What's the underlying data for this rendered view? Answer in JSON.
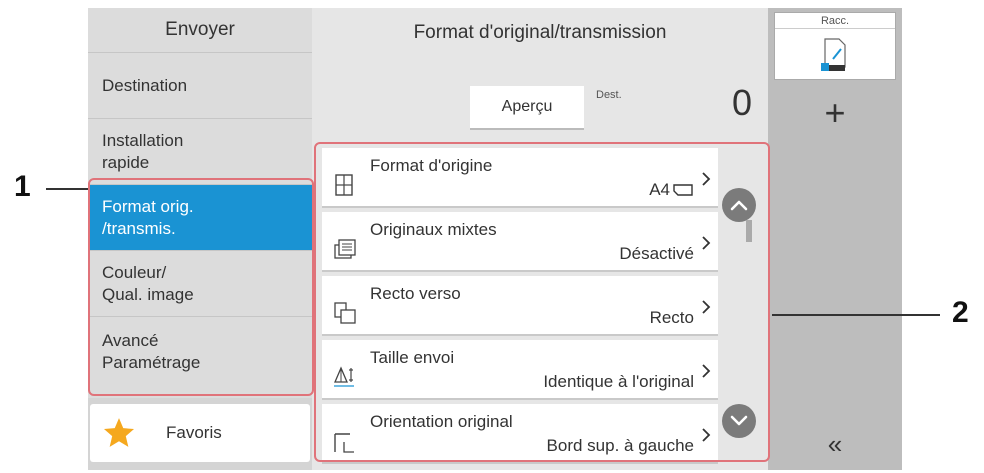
{
  "left_nav": {
    "header": "Envoyer",
    "items": [
      {
        "line1": "Destination",
        "line2": ""
      },
      {
        "line1": "Installation",
        "line2": "rapide"
      },
      {
        "line1": "Format orig.",
        "line2": "/transmis."
      },
      {
        "line1": "Couleur/",
        "line2": "Qual. image"
      },
      {
        "line1": "Avancé",
        "line2": "Paramétrage"
      }
    ],
    "active_index": 2,
    "favorites_label": "Favoris"
  },
  "center": {
    "title": "Format d'original/transmission",
    "tab_label": "Aperçu",
    "dest_label": "Dest.",
    "dest_count": "0",
    "rows": [
      {
        "name": "Format d'origine",
        "value": "A4",
        "icon": "original-size-icon",
        "value_icon": "paper-landscape-icon"
      },
      {
        "name": "Originaux mixtes",
        "value": "Désactivé",
        "icon": "mixed-originals-icon"
      },
      {
        "name": "Recto verso",
        "value": "Recto",
        "icon": "duplex-icon"
      },
      {
        "name": "Taille envoi",
        "value": "Identique à l'original",
        "icon": "send-size-icon"
      },
      {
        "name": "Orientation original",
        "value": "Bord sup. à gauche",
        "icon": "orientation-icon"
      }
    ]
  },
  "right": {
    "shortcut_label": "Racc.",
    "shortcut_icon": "shortcut-icon",
    "add_label": "+",
    "collapse_label": "«"
  },
  "callouts": {
    "left": "1",
    "right": "2"
  },
  "colors": {
    "accent": "#1a93d3",
    "callout_box": "#e0737a"
  }
}
